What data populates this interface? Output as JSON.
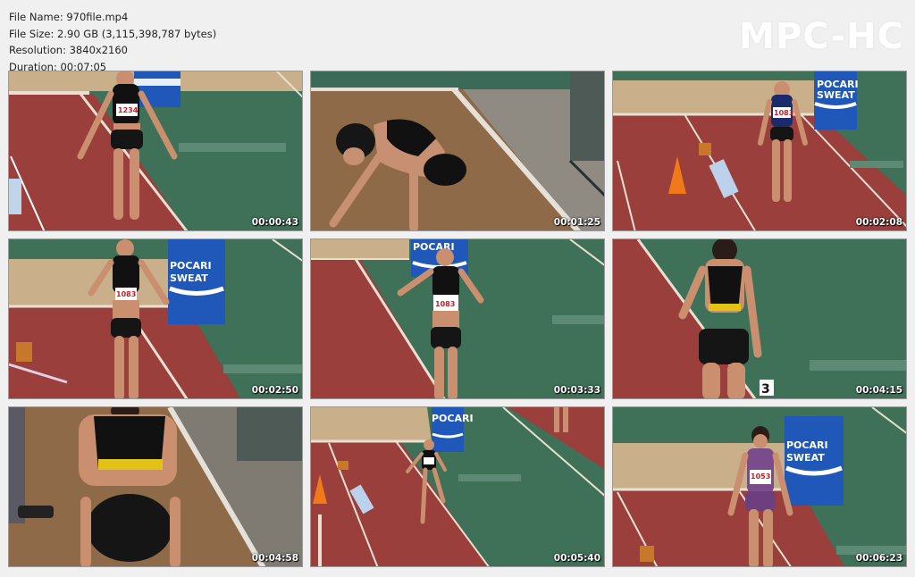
{
  "file_info": {
    "name_line": "File Name: 970file.mp4",
    "size_line": "File Size: 2.90 GB (3,115,398,787 bytes)",
    "resolution_line": "Resolution: 3840x2160",
    "duration_line": "Duration: 00:07:05"
  },
  "brand": "MPC-HC",
  "sign_text": {
    "line1": "POCARI",
    "line2": "SWEAT"
  },
  "lane_marker": "3",
  "thumbnails": [
    {
      "timestamp": "00:00:43",
      "bib": "1234"
    },
    {
      "timestamp": "00:01:25",
      "bib": ""
    },
    {
      "timestamp": "00:02:08",
      "bib": "1083"
    },
    {
      "timestamp": "00:02:50",
      "bib": "1083"
    },
    {
      "timestamp": "00:03:33",
      "bib": "1083"
    },
    {
      "timestamp": "00:04:15",
      "bib": ""
    },
    {
      "timestamp": "00:04:58",
      "bib": ""
    },
    {
      "timestamp": "00:05:40",
      "bib": ""
    },
    {
      "timestamp": "00:06:23",
      "bib": "1053"
    }
  ]
}
